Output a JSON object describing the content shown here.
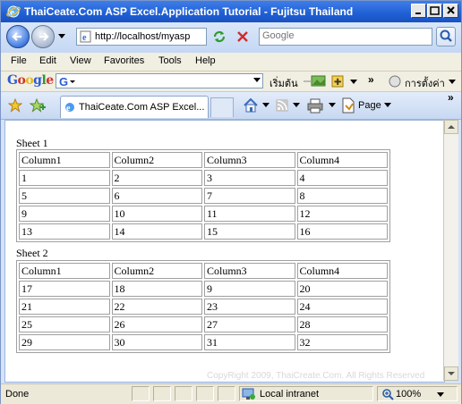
{
  "window": {
    "title": "ThaiCeate.Com ASP Excel.Application Tutorial - Fujitsu Thailand"
  },
  "address": {
    "url": "http://localhost/myasp"
  },
  "search": {
    "placeholder": "Google"
  },
  "menu": [
    "File",
    "Edit",
    "View",
    "Favorites",
    "Tools",
    "Help"
  ],
  "google_toolbar": {
    "logo": "Google",
    "start_label": "เริ่มต้น",
    "settings_label": "การตั้งค่า"
  },
  "tab": {
    "title": "ThaiCeate.Com ASP Excel..."
  },
  "commands": {
    "page_label": "Page"
  },
  "sheets": [
    {
      "title": "Sheet 1",
      "header": [
        "Column1",
        "Column2",
        "Column3",
        "Column4"
      ],
      "rows": [
        [
          "1",
          "2",
          "3",
          "4"
        ],
        [
          "5",
          "6",
          "7",
          "8"
        ],
        [
          "9",
          "10",
          "11",
          "12"
        ],
        [
          "13",
          "14",
          "15",
          "16"
        ]
      ]
    },
    {
      "title": "Sheet 2",
      "header": [
        "Column1",
        "Column2",
        "Column3",
        "Column4"
      ],
      "rows": [
        [
          "17",
          "18",
          "9",
          "20"
        ],
        [
          "21",
          "22",
          "23",
          "24"
        ],
        [
          "25",
          "26",
          "27",
          "28"
        ],
        [
          "29",
          "30",
          "31",
          "32"
        ]
      ]
    }
  ],
  "watermark": "CopyRight 2009, ThaiCreate.Com. All Rights Reserved",
  "status": {
    "text": "Done",
    "zone": "Local intranet",
    "zoom": "100%"
  },
  "colors": {
    "titlebar": "#1f5fd4",
    "chrome": "#d4e3f9",
    "grid_border": "#a0a0a0"
  }
}
